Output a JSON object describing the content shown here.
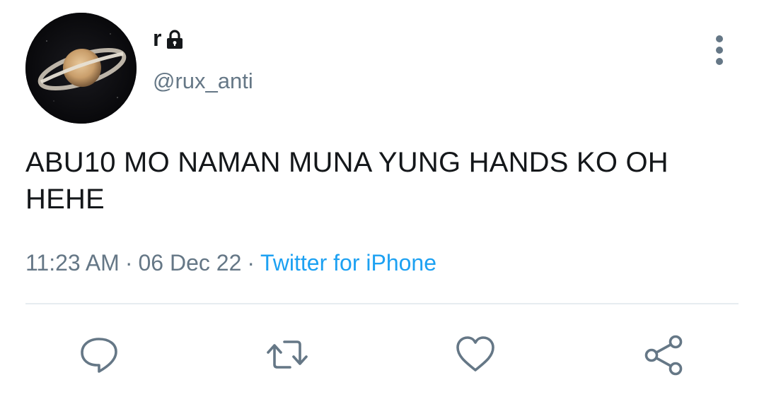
{
  "author": {
    "display_name": "r",
    "handle": "@rux_anti",
    "protected": true,
    "avatar_icon": "saturn-avatar"
  },
  "tweet": {
    "text": "ABU10 MO NAMAN MUNA YUNG HANDS KO OH HEHE",
    "time": "11:23 AM",
    "separator": "·",
    "date": "06 Dec 22",
    "source": "Twitter for iPhone"
  },
  "actions": {
    "reply_icon": "reply-icon",
    "retweet_icon": "retweet-icon",
    "like_icon": "heart-icon",
    "share_icon": "share-icon"
  },
  "colors": {
    "text": "#14171a",
    "secondary": "#657786",
    "link": "#1da1f2",
    "divider": "#e6ecf0"
  }
}
